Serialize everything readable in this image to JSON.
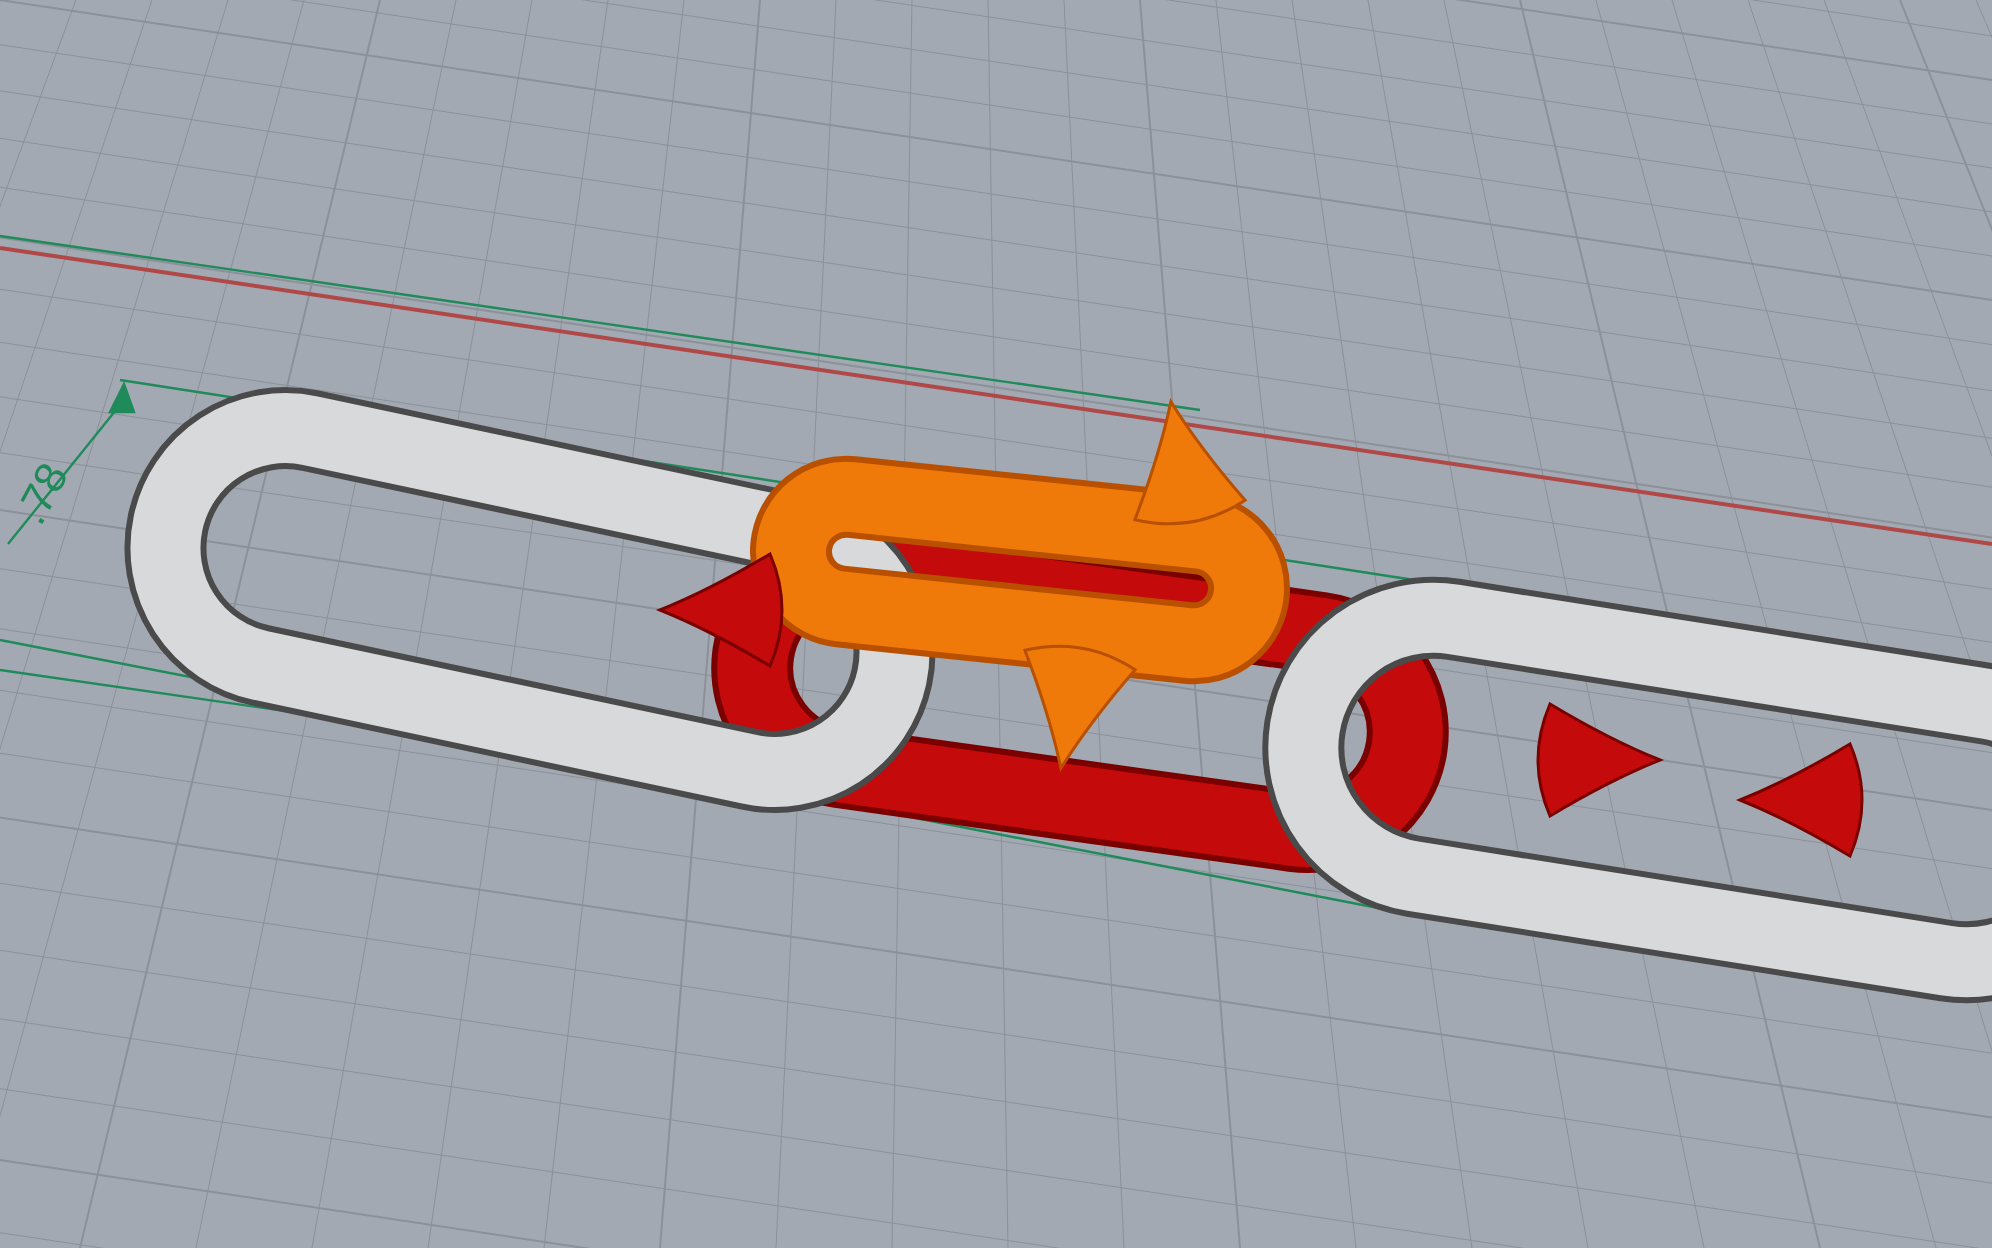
{
  "viewport": {
    "dimension": {
      "text": ".78"
    }
  }
}
